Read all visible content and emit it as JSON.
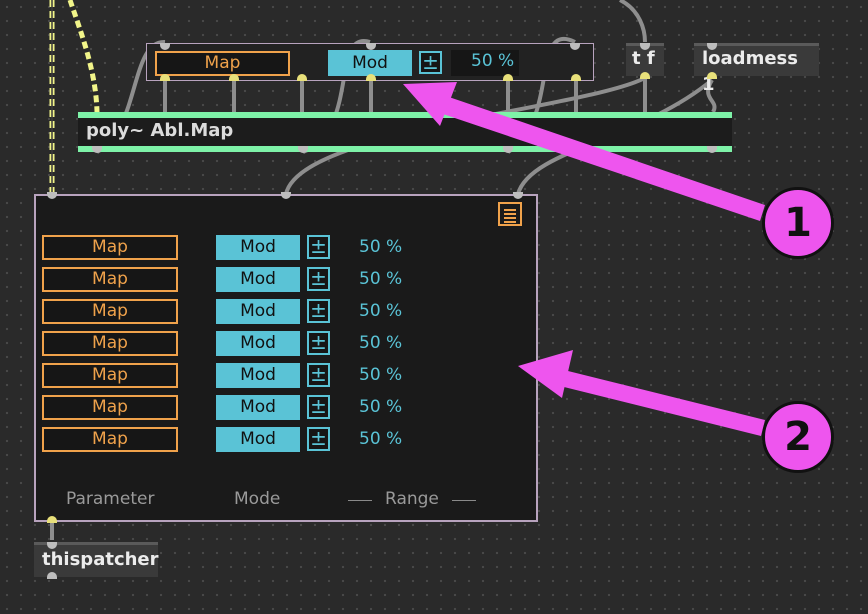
{
  "top_row": {
    "map_label": "Map",
    "mod_label": "Mod",
    "plusminus": "±",
    "range_value": "50 %"
  },
  "objects": {
    "tf": "t f",
    "loadmess": "loadmess 1",
    "poly": "poly~ Abl.Map",
    "thispatcher": "thispatcher"
  },
  "rows": [
    {
      "map": "Map",
      "mod": "Mod",
      "pm": "±",
      "value": "50 %"
    },
    {
      "map": "Map",
      "mod": "Mod",
      "pm": "±",
      "value": "50 %"
    },
    {
      "map": "Map",
      "mod": "Mod",
      "pm": "±",
      "value": "50 %"
    },
    {
      "map": "Map",
      "mod": "Mod",
      "pm": "±",
      "value": "50 %"
    },
    {
      "map": "Map",
      "mod": "Mod",
      "pm": "±",
      "value": "50 %"
    },
    {
      "map": "Map",
      "mod": "Mod",
      "pm": "±",
      "value": "50 %"
    },
    {
      "map": "Map",
      "mod": "Mod",
      "pm": "±",
      "value": "50 %"
    }
  ],
  "footer": {
    "parameter": "Parameter",
    "mode": "Mode",
    "range": "Range"
  },
  "callouts": {
    "one": "1",
    "two": "2"
  },
  "colors": {
    "map_orange": "#f0a24b",
    "mod_cyan": "#5ac3d6",
    "poly_green": "#7ef2a8",
    "callout_magenta": "#ee55ee"
  }
}
